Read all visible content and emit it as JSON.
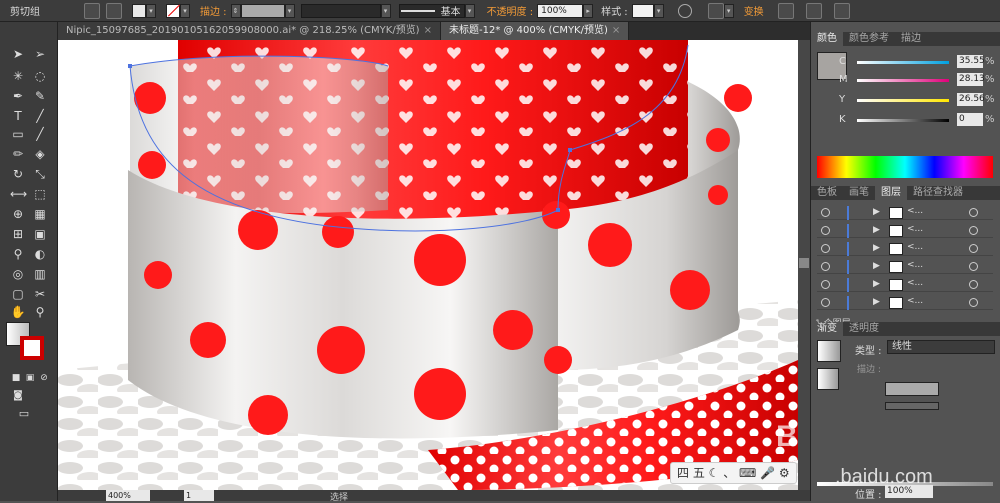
{
  "control_bar": {
    "group_label": "剪切组",
    "stroke_label": "描边 :",
    "brush_label": "基本",
    "opacity_label": "不透明度 :",
    "opacity_value": "100%",
    "style_label": "样式 :",
    "transform_label": "变换"
  },
  "tabs": [
    {
      "label": "Nipic_15097685_20190105162059908000.ai* @ 218.25% (CMYK/预览)"
    },
    {
      "label": "未标题-12* @ 400% (CMYK/预览)"
    }
  ],
  "color_panel": {
    "tabs": [
      "颜色",
      "颜色参考",
      "描边"
    ],
    "channels": [
      {
        "letter": "C",
        "value": "35.55"
      },
      {
        "letter": "M",
        "value": "28.13"
      },
      {
        "letter": "Y",
        "value": "26.56"
      },
      {
        "letter": "K",
        "value": "0"
      }
    ],
    "percent": "%"
  },
  "layers_panel": {
    "tabs": [
      "色板",
      "画笔",
      "图层",
      "路径查找器"
    ],
    "rows": [
      {
        "name": "<..."
      },
      {
        "name": "<..."
      },
      {
        "name": "<..."
      },
      {
        "name": "<..."
      },
      {
        "name": "<..."
      },
      {
        "name": "<..."
      }
    ],
    "footer": "1 个图层"
  },
  "gradient_panel": {
    "tabs": [
      "渐变",
      "透明度"
    ],
    "type_label": "类型 :",
    "type_value": "线性",
    "stroke_label": "描边 :",
    "position_label": "位置 :",
    "position_value": "100%"
  },
  "status_bar": {
    "zoom": "400%",
    "page": "1",
    "mode": "选择"
  },
  "watermark": {
    "text1": "Bai",
    "text2": "jing",
    "text3": ".baidu.com",
    "overlay": "四 五 ☾ 、 ⌨ 🎤 ⚙"
  },
  "colors": {
    "red": "#ff1a1a",
    "panel_bg": "#535353",
    "chrome": "#3c3c3c",
    "accent_blue": "#4b7bd8",
    "orange": "#f29b38"
  }
}
